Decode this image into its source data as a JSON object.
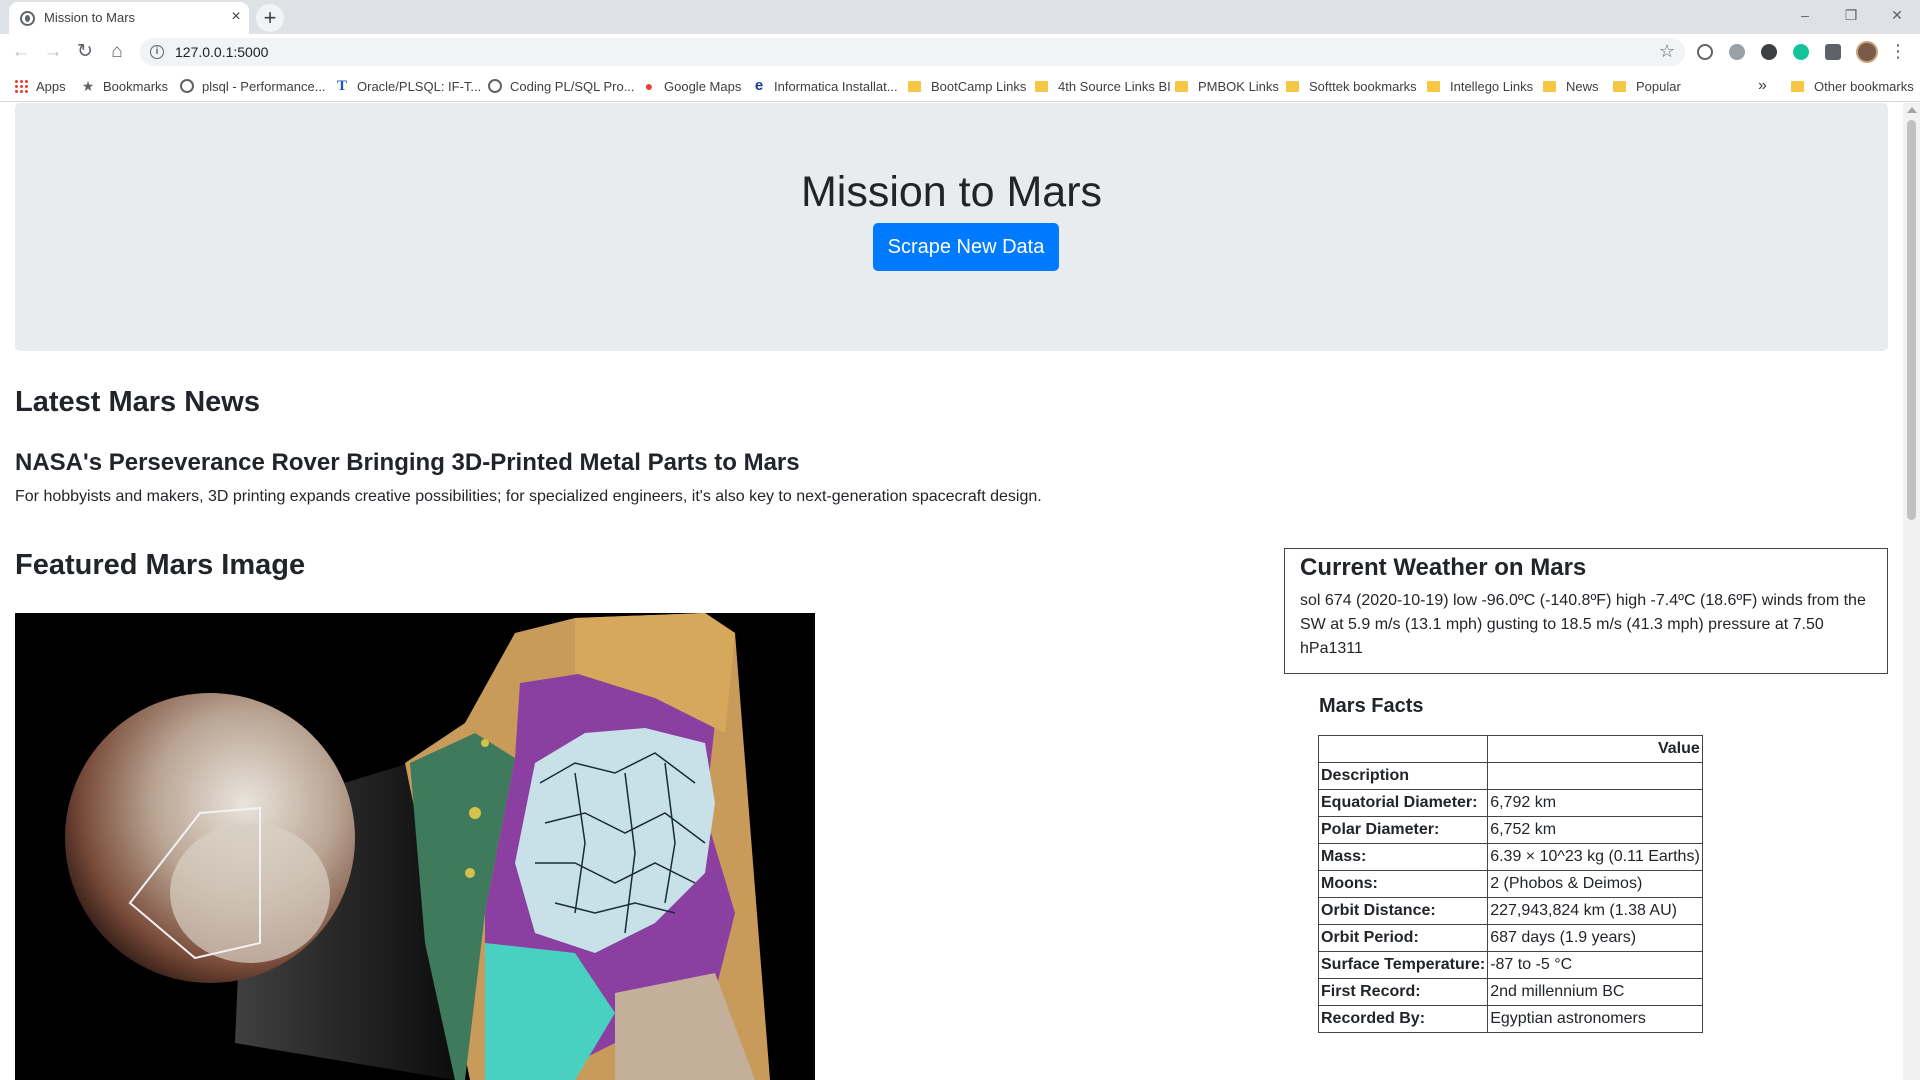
{
  "browser": {
    "tab_title": "Mission to Mars",
    "tab_close": "×",
    "new_tab": "+",
    "url": "127.0.0.1:5000",
    "window_controls": [
      "–",
      "❐",
      "✕"
    ],
    "bookmarks": [
      {
        "label": "Apps",
        "icon": "apps-grid-icon"
      },
      {
        "label": "Bookmarks",
        "icon": "star-icon"
      },
      {
        "label": "plsql - Performance...",
        "icon": "globe-icon"
      },
      {
        "label": "Oracle/PLSQL: IF-T...",
        "icon": "t-icon"
      },
      {
        "label": "Coding PL/SQL Pro...",
        "icon": "globe-icon"
      },
      {
        "label": "Google Maps",
        "icon": "map-pin-icon"
      },
      {
        "label": "Informatica Installat...",
        "icon": "e-icon"
      },
      {
        "label": "BootCamp Links",
        "icon": "folder-icon"
      },
      {
        "label": "4th Source Links BI",
        "icon": "folder-icon"
      },
      {
        "label": "PMBOK Links",
        "icon": "folder-icon"
      },
      {
        "label": "Softtek bookmarks",
        "icon": "folder-icon"
      },
      {
        "label": "Intellego Links",
        "icon": "folder-icon"
      },
      {
        "label": "News",
        "icon": "folder-icon"
      },
      {
        "label": "Popular",
        "icon": "folder-icon"
      }
    ],
    "bookmarks_overflow": "»",
    "other_bookmarks": "Other bookmarks"
  },
  "page": {
    "title": "Mission to Mars",
    "scrape_button": "Scrape New Data",
    "news_heading": "Latest Mars News",
    "news_title": "NASA's Perseverance Rover Bringing 3D-Printed Metal Parts to Mars",
    "news_paragraph": "For hobbyists and makers, 3D printing expands creative possibilities; for specialized engineers, it's also key to next-generation spacecraft design.",
    "featured_heading": "Featured Mars Image",
    "weather_heading": "Current Weather on Mars",
    "weather_text": "sol 674 (2020-10-19) low -96.0ºC (-140.8ºF) high -7.4ºC (18.6ºF) winds from the SW at 5.9 m/s (13.1 mph) gusting to 18.5 m/s (41.3 mph) pressure at 7.50 hPa1311",
    "facts_heading": "Mars Facts",
    "facts_header": {
      "key": "",
      "value": "Value"
    },
    "facts_index_label": "Description",
    "facts": [
      {
        "key": "Equatorial Diameter:",
        "value": "6,792 km"
      },
      {
        "key": "Polar Diameter:",
        "value": "6,752 km"
      },
      {
        "key": "Mass:",
        "value": "6.39 × 10^23 kg (0.11 Earths)"
      },
      {
        "key": "Moons:",
        "value": "2 (Phobos & Deimos)"
      },
      {
        "key": "Orbit Distance:",
        "value": "227,943,824 km (1.38 AU)"
      },
      {
        "key": "Orbit Period:",
        "value": "687 days (1.9 years)"
      },
      {
        "key": "Surface Temperature:",
        "value": "-87 to -5 °C"
      },
      {
        "key": "First Record:",
        "value": "2nd millennium BC"
      },
      {
        "key": "Recorded By:",
        "value": "Egyptian astronomers"
      }
    ]
  },
  "colors": {
    "primary_button": "#007bff",
    "jumbotron_bg": "#e9ecef",
    "text": "#212529"
  }
}
